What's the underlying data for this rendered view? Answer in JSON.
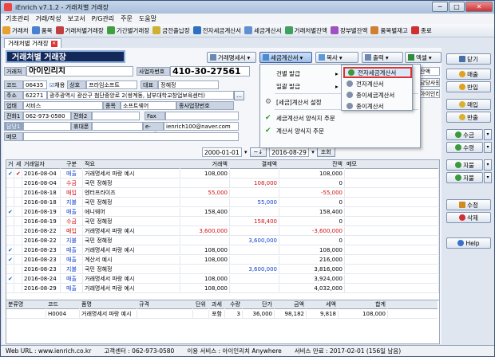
{
  "window": {
    "title": "iEnrich v7.1.2 - 거래처별 거래장",
    "buttons": [
      "─",
      "□",
      "✕"
    ]
  },
  "menu": [
    "기초관리",
    "거래/작성",
    "보고서",
    "P/G관리",
    "주문",
    "도움말"
  ],
  "toolbar": [
    "거래처",
    "품목",
    "거래처별거래장",
    "기간별거래장",
    "금전출납장",
    "전자세금계산서",
    "세금계산서",
    "거래처별잔액",
    "장부별잔액",
    "품목별재고",
    "종료"
  ],
  "toolbar_colors": [
    "#e8a030",
    "#4a80d0",
    "#c04040",
    "#40a040",
    "#d0b030",
    "#3070c0",
    "#6090d0",
    "#40a060",
    "#a050c0",
    "#d08030",
    "#d03030"
  ],
  "tab": {
    "label": "거래처별 거래장"
  },
  "page_title": "거래처별 거래장",
  "actions": {
    "statement": "거래명세서",
    "tax_invoice": "세금계산서",
    "copy": "복사",
    "print": "출력",
    "excel": "엑셀",
    "close": "닫기"
  },
  "form": {
    "client_label": "거래처",
    "client_value": "아이인리치",
    "bizno_label": "사업자번호",
    "bizno_value": "410-30-27561",
    "code_label": "코드",
    "code_value": "06435",
    "adopt_label": "채용",
    "trade_label": "상호",
    "trade_value": "프라임소프트",
    "rep_label": "대표",
    "rep_value": "정혜정",
    "addr_label": "주소",
    "zip_value": "62271",
    "addr_value": "광주광역시 광산구 첨단중앙로 2(쌍계동, 남부대학교창업보육센터)",
    "biztype_label": "업태",
    "biztype_value": "서비스",
    "item_label": "종목",
    "item_value": "소프트웨어",
    "branch_value": "종사업장번호",
    "tel1_label": "전화1",
    "tel1_value": "062-973-0580",
    "tel2_label": "전화2",
    "tel2_value": "",
    "fax_label": "Fax",
    "fax_value": "",
    "manager_label": "담당1",
    "mobile_label": "휴대폰",
    "mobile_value": "",
    "email_label": "e-mail",
    "email_value": "ienrich100@naver.com",
    "memo_label": "메모",
    "memo_value": ""
  },
  "dropdown": {
    "items": [
      {
        "label": "건별 발급",
        "has_arrow": true
      },
      {
        "label": "일괄 발급",
        "has_arrow": true
      },
      {
        "label": "[세금]계산서 설정",
        "has_arrow": false
      },
      {
        "label": "세금계산서 양식지 주문",
        "has_arrow": false
      },
      {
        "label": "계산서 양식지 주문",
        "has_arrow": false
      }
    ],
    "submenu": [
      {
        "label": "전자세금계산서",
        "highlighted": true
      },
      {
        "label": "전자계산서",
        "highlighted": false
      },
      {
        "label": "종이세금계산서",
        "highlighted": false
      },
      {
        "label": "종이계산서",
        "highlighted": false
      }
    ]
  },
  "partial_right": {
    "a": "잔액",
    "b": "담당사원",
    "c": "아이인리치"
  },
  "date_filter": {
    "from": "2000-01-01",
    "to": "2016-08-29",
    "mid": "~↓",
    "query": "조회"
  },
  "right_buttons": {
    "close": "닫기",
    "sales": "매출",
    "sales_return": "반입",
    "purchase": "매입",
    "purchase_return": "반출",
    "receive": "수금",
    "pay_recv": "수령",
    "payment": "지불",
    "pay_give": "지불",
    "edit": "수정",
    "delete": "삭제",
    "help": "Help"
  },
  "table": {
    "headers": [
      "거",
      "세",
      "거래일자",
      "구분",
      "적요",
      "거래액",
      "결제액",
      "잔액",
      "메모"
    ],
    "rows": [
      {
        "chk1": "✔",
        "chk2": "✔",
        "date": "2016-08-04",
        "type": "매출",
        "desc": "거래명세서 파랑 예시",
        "amount": "108,000",
        "paid": "",
        "balance": "108,000",
        "memo": ""
      },
      {
        "chk1": "",
        "chk2": "",
        "date": "2016-08-04",
        "type": "수금",
        "desc": "국민 정혜정",
        "amount": "",
        "paid": "108,000",
        "balance": "0",
        "memo": ""
      },
      {
        "chk1": "",
        "chk2": "",
        "date": "2016-08-18",
        "type": "매입",
        "desc": "엔터프라이즈",
        "amount": "55,000",
        "paid": "",
        "balance": "-55,000",
        "memo": ""
      },
      {
        "chk1": "",
        "chk2": "",
        "date": "2016-08-18",
        "type": "지불",
        "desc": "국민 정혜정",
        "amount": "",
        "paid": "55,000",
        "balance": "0",
        "memo": ""
      },
      {
        "chk1": "✔",
        "chk2": "",
        "date": "2016-08-19",
        "type": "매출",
        "desc": "에니웨어",
        "amount": "158,400",
        "paid": "",
        "balance": "158,400",
        "memo": ""
      },
      {
        "chk1": "",
        "chk2": "",
        "date": "2016-08-19",
        "type": "수금",
        "desc": "국민 정혜정",
        "amount": "",
        "paid": "158,400",
        "balance": "0",
        "memo": ""
      },
      {
        "chk1": "",
        "chk2": "",
        "date": "2016-08-22",
        "type": "매입",
        "desc": "거래명세서 파랑 예시",
        "amount": "3,600,000",
        "paid": "",
        "balance": "-3,600,000",
        "memo": ""
      },
      {
        "chk1": "",
        "chk2": "",
        "date": "2016-08-22",
        "type": "지불",
        "desc": "국민 정혜정",
        "amount": "",
        "paid": "3,600,000",
        "balance": "0",
        "memo": ""
      },
      {
        "chk1": "✔",
        "chk2": "",
        "date": "2016-08-23",
        "type": "매출",
        "desc": "거래명세서 파랑 예시",
        "amount": "108,000",
        "paid": "",
        "balance": "108,000",
        "memo": ""
      },
      {
        "chk1": "✔",
        "chk2": "",
        "date": "2016-08-23",
        "type": "매출",
        "desc": "계산서 예시",
        "amount": "108,000",
        "paid": "",
        "balance": "216,000",
        "memo": ""
      },
      {
        "chk1": "",
        "chk2": "",
        "date": "2016-08-23",
        "type": "지불",
        "desc": "국민 정혜정",
        "amount": "",
        "paid": "3,600,000",
        "balance": "3,816,000",
        "memo": ""
      },
      {
        "chk1": "✔",
        "chk2": "",
        "date": "2016-08-24",
        "type": "매출",
        "desc": "거래명세서 파랑 예시",
        "amount": "108,000",
        "paid": "",
        "balance": "3,924,000",
        "memo": ""
      },
      {
        "chk1": "",
        "chk2": "",
        "date": "2016-08-29",
        "type": "매출",
        "desc": "거래명세서 파랑 예시",
        "amount": "108,000",
        "paid": "",
        "balance": "4,032,000",
        "memo": ""
      }
    ]
  },
  "detail": {
    "headers": [
      "분류명",
      "코드",
      "품명",
      "규격",
      "단위",
      "과세",
      "수량",
      "단가",
      "금액",
      "세액",
      "합계"
    ],
    "rows": [
      {
        "cat": "",
        "code": "H0004",
        "name": "거래명세서 파랑 예시",
        "spec": "",
        "unit": "",
        "tax": "포함",
        "qty": "3",
        "price": "36,000",
        "amount": "98,182",
        "vat": "9,818",
        "total": "108,000"
      }
    ]
  },
  "status": {
    "url": "Web URL : www.ienrich.co.kr",
    "center": "고객센터 : 062-973-0580",
    "service": "이용 서비스 : 아이인리치 Anywhere",
    "period": "서비스 만료 : 2017-02-01 (156일 남음)"
  }
}
